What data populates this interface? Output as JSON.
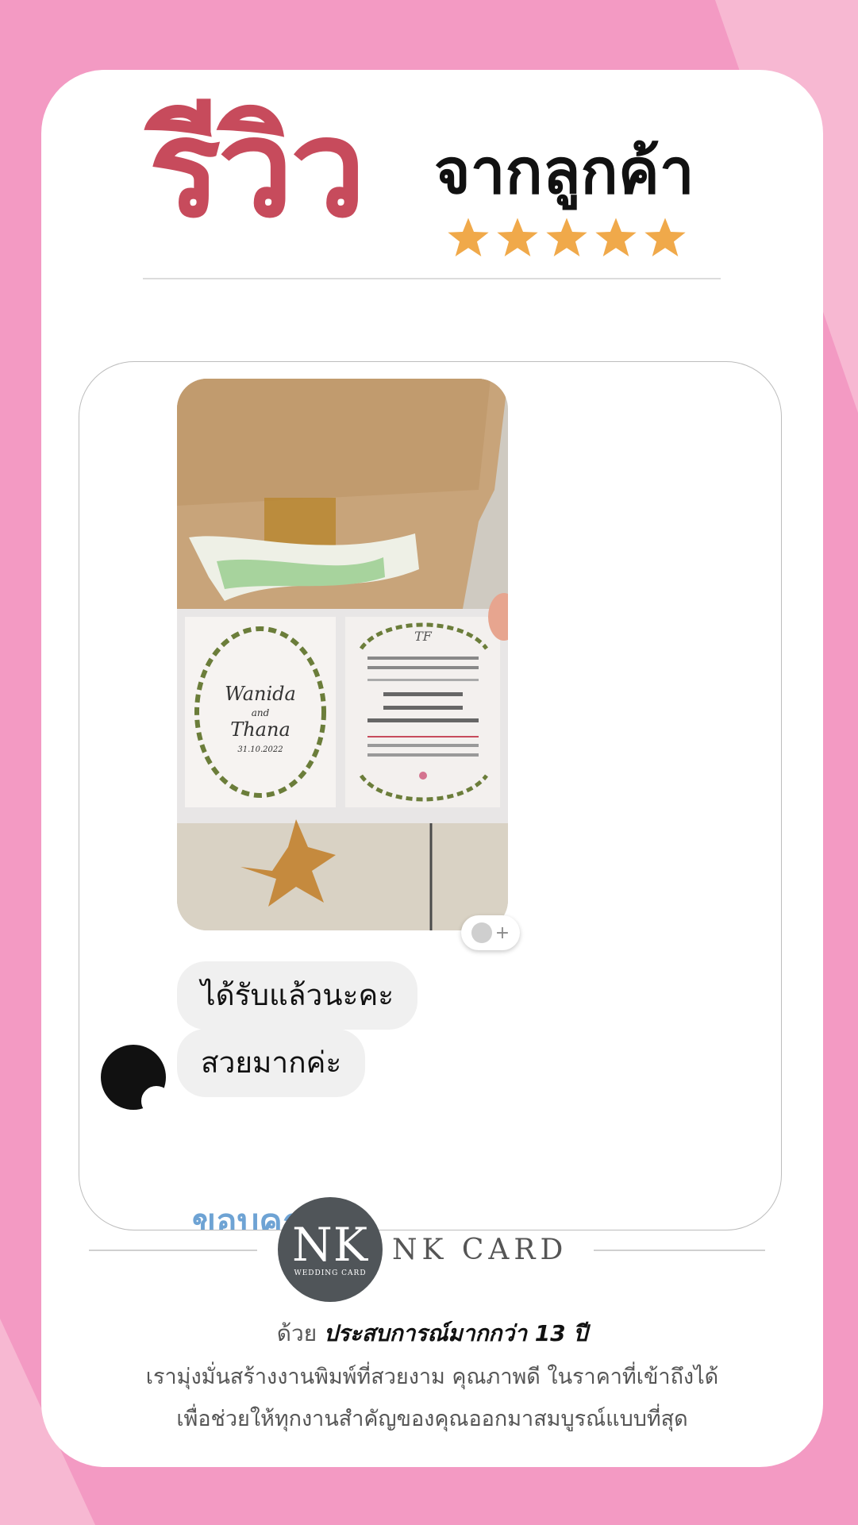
{
  "header": {
    "review_word": "รีวิว",
    "from_customer": "จากลูกค้า",
    "rating_stars": 5,
    "star_color": "#f0a94a",
    "title_color": "#c74b5c"
  },
  "chat": {
    "photo_card_left": {
      "name1": "Wanida",
      "and": "and",
      "name2": "Thana",
      "date": "31.10.2022"
    },
    "photo_card_right_monogram": "TF",
    "reaction_icon": "emoji-add-icon",
    "reaction_plus": "+",
    "messages": [
      {
        "text": "ได้รับแล้วนะคะ"
      },
      {
        "text": "สวยมากค่ะ"
      }
    ],
    "partial_message": "ขอบคุณจ้า"
  },
  "footer": {
    "logo_text": "NK",
    "logo_sub": "WEDDING CARD",
    "brand_name": "NK CARD",
    "line1_prefix": "ด้วย",
    "line1_bold": "ประสบการณ์มากกว่า 13 ปี",
    "line2": "เรามุ่งมั่นสร้างงานพิมพ์ที่สวยงาม คุณภาพดี ในราคาที่เข้าถึงได้",
    "line3": "เพื่อช่วยให้ทุกงานสำคัญของคุณออกมาสมบูรณ์แบบที่สุด"
  }
}
